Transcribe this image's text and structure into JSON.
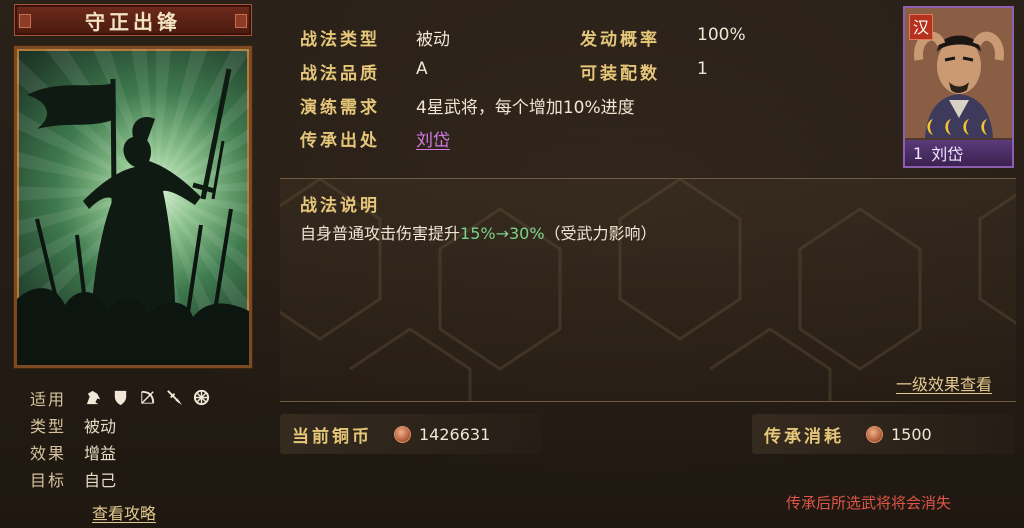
{
  "skill": {
    "name": "守正出锋"
  },
  "meta": {
    "suitable_label": "适用",
    "suitable_icons": [
      "cavalry-icon",
      "shield-icon",
      "bow-icon",
      "spear-icon",
      "wheel-icon"
    ],
    "type_label": "类型",
    "type_value": "被动",
    "effect_label": "效果",
    "effect_value": "增益",
    "target_label": "目标",
    "target_value": "自己",
    "guide_link": "查看攻略"
  },
  "info": {
    "tactic_type_label": "战法类型",
    "tactic_type_value": "被动",
    "trigger_rate_label": "发动概率",
    "trigger_rate_value": "100%",
    "quality_label": "战法品质",
    "quality_value": "A",
    "equip_count_label": "可装配数",
    "equip_count_value": "1",
    "practice_label": "演练需求",
    "practice_value": "4星武将，每个增加10%进度",
    "inherit_label": "传承出处",
    "inherit_value": "刘岱"
  },
  "hero": {
    "faction": "汉",
    "stars": 4,
    "level": "1",
    "name": "刘岱"
  },
  "description": {
    "title": "战法说明",
    "text_before": "自身普通攻击伤害提升",
    "text_highlight": "15%→30%",
    "text_after": "（受武力影响）",
    "level_link": "一级效果查看"
  },
  "currency": {
    "current_label": "当前铜币",
    "current_value": "1426631",
    "cost_label": "传承消耗",
    "cost_value": "1500"
  },
  "warning": "传承后所选武将将会消失",
  "colors": {
    "accent_gold": "#e6c77a",
    "link_purple": "#d27ae2",
    "highlight_green": "#7cd28a",
    "warning_red": "#e05545",
    "faction_red": "#b6321f"
  }
}
